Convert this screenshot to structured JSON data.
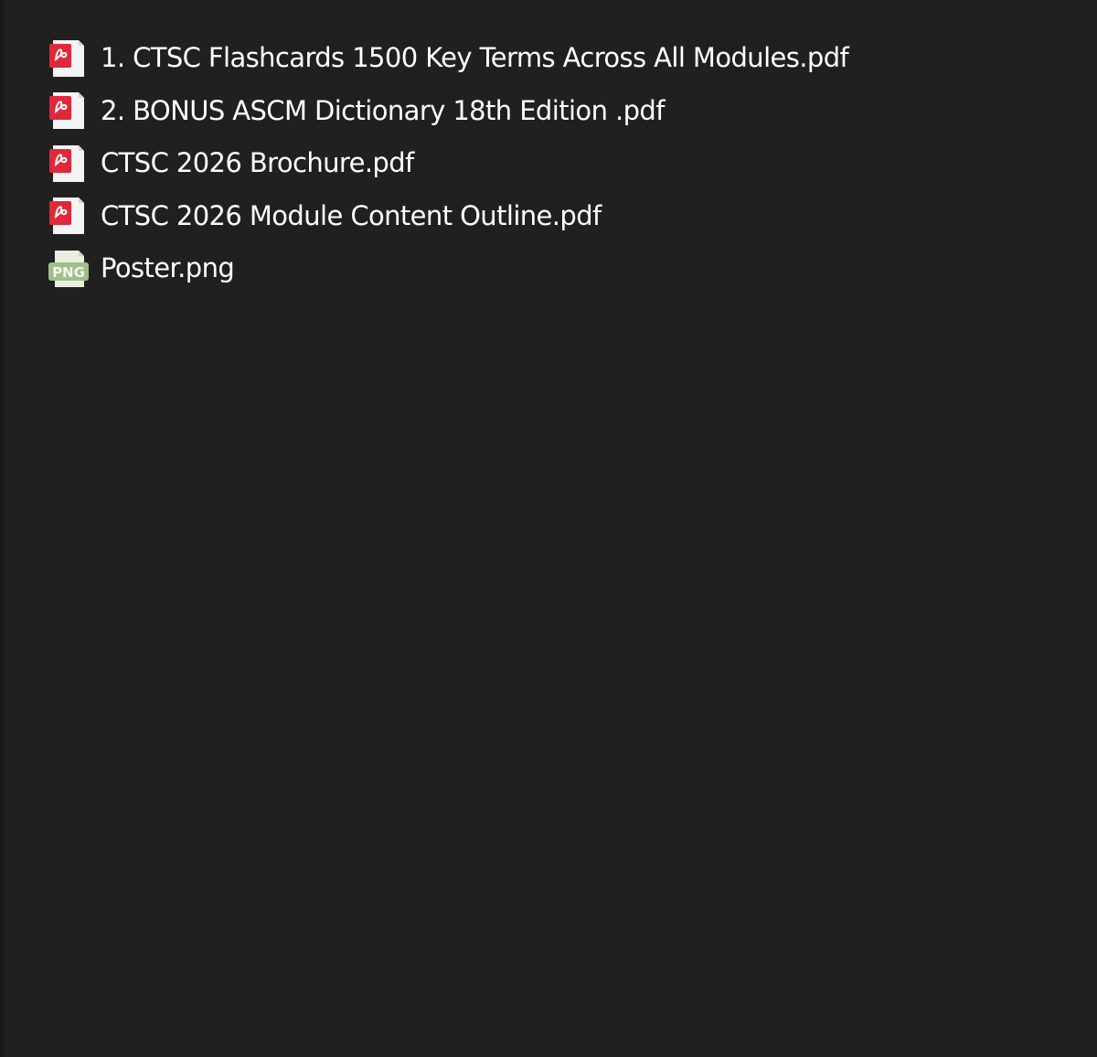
{
  "files": [
    {
      "name": "1. CTSC Flashcards 1500 Key Terms Across All Modules.pdf",
      "type": "pdf",
      "icon": "pdf-file-icon"
    },
    {
      "name": "2. BONUS ASCM Dictionary 18th Edition .pdf",
      "type": "pdf",
      "icon": "pdf-file-icon"
    },
    {
      "name": "CTSC 2026 Brochure.pdf",
      "type": "pdf",
      "icon": "pdf-file-icon"
    },
    {
      "name": "CTSC 2026 Module Content Outline.pdf",
      "type": "pdf",
      "icon": "pdf-file-icon"
    },
    {
      "name": "Poster.png",
      "type": "png",
      "icon": "png-file-icon"
    }
  ],
  "colors": {
    "background": "#202020",
    "text": "#ffffff",
    "pdf_accent": "#e0283a",
    "png_accent": "#9fc08a"
  }
}
